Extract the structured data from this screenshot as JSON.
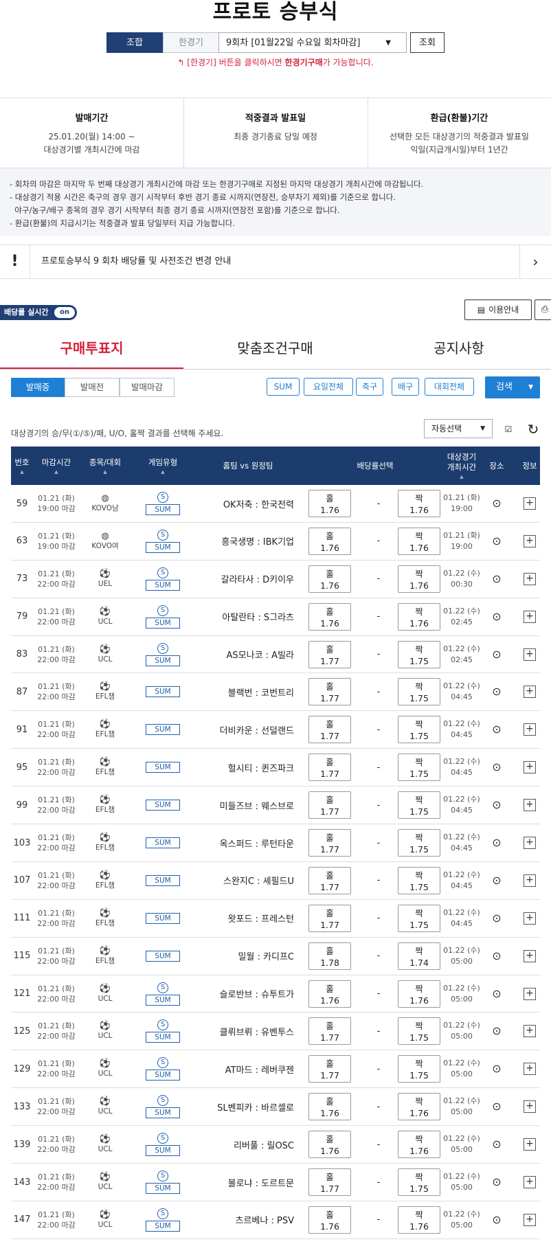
{
  "header": {
    "title": "프로토 승부식"
  },
  "toolbar": {
    "combo_label": "조합",
    "limit_label": "한경기",
    "round_value": "9회차 [01월22일 수요일 회차마감]",
    "search_label": "조회",
    "hint_pre": "[한경기] 버튼을 클릭하시면 ",
    "hint_bold": "한경기구매",
    "hint_post": "가 가능합니다."
  },
  "info": [
    {
      "title": "발매기간",
      "lines": [
        "25.01.20(월) 14:00 ~",
        "대상경기별 개최시간에 마감"
      ]
    },
    {
      "title": "적중결과 발표일",
      "lines": [
        "최종 경기종료 당일 예정"
      ]
    },
    {
      "title": "환급(환불)기간",
      "lines": [
        "선택한 모든 대상경기의 적중결과 발표일",
        "익일(지급개시일)부터 1년간"
      ]
    }
  ],
  "notes": [
    "- 회차의 마감은 마지막 두 번째 대상경기 개최시간에 마감 또는 한경기구매로 지정된 마지막 대상경기 개최시간에 마감됩니다.",
    "- 대상경기 적용 시간은 축구의 경우 경기 시작부터 후반 경기 종료 시까지(연장전, 승부차기 제외)를 기준으로 합니다.",
    "  야구/농구/배구 종목의 경우 경기 시작부터 최종 경기 종료 시까지(연장전 포함)를 기준으로 합니다.",
    "- 환급(환불)의 지급시기는 적중결과 발표 당일부터 지급 가능합니다."
  ],
  "notice_bar": {
    "text": "프로토승부식 9 회차 배당률 및 사전조건 변경 안내"
  },
  "live_toggle": {
    "label": "배당률 실시간",
    "state": "on"
  },
  "guide_button": {
    "label": "이용안내"
  },
  "tabs": [
    "구매투표지",
    "맞춤조건구매",
    "공지사항"
  ],
  "status_buttons": [
    "발매중",
    "발매전",
    "발매마감"
  ],
  "filters": {
    "sum": "SUM",
    "day": "요일전체",
    "soccer": "축구",
    "volley": "배구",
    "league": "대회전체",
    "search": "검색"
  },
  "select_guide": "대상경기의 승/무(①/⑤)/패, U/O, 홀짝 결과를 선택해 주세요.",
  "auto_select": "자동선택",
  "table": {
    "headers": {
      "no": "번호",
      "deadline": "마감시간",
      "league": "종목/대회",
      "type": "게임유형",
      "teams": "홈팀 vs 원정팀",
      "odds": "배당률선택",
      "kickoff1": "대상경기",
      "kickoff2": "개최시간",
      "venue": "장소",
      "info": "정보"
    },
    "rows": [
      {
        "no": "59",
        "dl_date": "01.21 (화)",
        "dl_time": "19:00 마감",
        "sport": "volley",
        "league": "KOVO남",
        "special": true,
        "teams": "OK저축 : 한국전력",
        "odd1_label": "홀",
        "odd1": "1.76",
        "dash": "-",
        "odd2_label": "짝",
        "odd2": "1.76",
        "ko_date": "01.21 (화)",
        "ko_time": "19:00"
      },
      {
        "no": "63",
        "dl_date": "01.21 (화)",
        "dl_time": "19:00 마감",
        "sport": "volley",
        "league": "KOVO여",
        "special": true,
        "teams": "흥국생명 : IBK기업",
        "odd1_label": "홀",
        "odd1": "1.76",
        "dash": "-",
        "odd2_label": "짝",
        "odd2": "1.76",
        "ko_date": "01.21 (화)",
        "ko_time": "19:00"
      },
      {
        "no": "73",
        "dl_date": "01.21 (화)",
        "dl_time": "22:00 마감",
        "sport": "soccer",
        "league": "UEL",
        "special": true,
        "teams": "갈라타사 : D키이우",
        "odd1_label": "홀",
        "odd1": "1.76",
        "dash": "-",
        "odd2_label": "짝",
        "odd2": "1.76",
        "ko_date": "01.22 (수)",
        "ko_time": "00:30"
      },
      {
        "no": "79",
        "dl_date": "01.21 (화)",
        "dl_time": "22:00 마감",
        "sport": "soccer",
        "league": "UCL",
        "special": true,
        "teams": "아탈란타 : S그라츠",
        "odd1_label": "홀",
        "odd1": "1.76",
        "dash": "-",
        "odd2_label": "짝",
        "odd2": "1.76",
        "ko_date": "01.22 (수)",
        "ko_time": "02:45"
      },
      {
        "no": "83",
        "dl_date": "01.21 (화)",
        "dl_time": "22:00 마감",
        "sport": "soccer",
        "league": "UCL",
        "special": true,
        "teams": "AS모나코 : A빌라",
        "odd1_label": "홀",
        "odd1": "1.77",
        "dash": "-",
        "odd2_label": "짝",
        "odd2": "1.75",
        "ko_date": "01.22 (수)",
        "ko_time": "02:45"
      },
      {
        "no": "87",
        "dl_date": "01.21 (화)",
        "dl_time": "22:00 마감",
        "sport": "soccer",
        "league": "EFL챔",
        "special": false,
        "teams": "블랙번 : 코번트리",
        "odd1_label": "홀",
        "odd1": "1.77",
        "dash": "-",
        "odd2_label": "짝",
        "odd2": "1.75",
        "ko_date": "01.22 (수)",
        "ko_time": "04:45"
      },
      {
        "no": "91",
        "dl_date": "01.21 (화)",
        "dl_time": "22:00 마감",
        "sport": "soccer",
        "league": "EFL챔",
        "special": false,
        "teams": "더비카운 : 선덜랜드",
        "odd1_label": "홀",
        "odd1": "1.77",
        "dash": "-",
        "odd2_label": "짝",
        "odd2": "1.75",
        "ko_date": "01.22 (수)",
        "ko_time": "04:45"
      },
      {
        "no": "95",
        "dl_date": "01.21 (화)",
        "dl_time": "22:00 마감",
        "sport": "soccer",
        "league": "EFL챔",
        "special": false,
        "teams": "헐시티 : 퀸즈파크",
        "odd1_label": "홀",
        "odd1": "1.77",
        "dash": "-",
        "odd2_label": "짝",
        "odd2": "1.75",
        "ko_date": "01.22 (수)",
        "ko_time": "04:45"
      },
      {
        "no": "99",
        "dl_date": "01.21 (화)",
        "dl_time": "22:00 마감",
        "sport": "soccer",
        "league": "EFL챔",
        "special": false,
        "teams": "미들즈브 : 웨스브로",
        "odd1_label": "홀",
        "odd1": "1.77",
        "dash": "-",
        "odd2_label": "짝",
        "odd2": "1.75",
        "ko_date": "01.22 (수)",
        "ko_time": "04:45"
      },
      {
        "no": "103",
        "dl_date": "01.21 (화)",
        "dl_time": "22:00 마감",
        "sport": "soccer",
        "league": "EFL챔",
        "special": false,
        "teams": "옥스퍼드 : 루턴타운",
        "odd1_label": "홀",
        "odd1": "1.77",
        "dash": "-",
        "odd2_label": "짝",
        "odd2": "1.75",
        "ko_date": "01.22 (수)",
        "ko_time": "04:45"
      },
      {
        "no": "107",
        "dl_date": "01.21 (화)",
        "dl_time": "22:00 마감",
        "sport": "soccer",
        "league": "EFL챔",
        "special": false,
        "teams": "스완지C : 셰필드U",
        "odd1_label": "홀",
        "odd1": "1.77",
        "dash": "-",
        "odd2_label": "짝",
        "odd2": "1.75",
        "ko_date": "01.22 (수)",
        "ko_time": "04:45"
      },
      {
        "no": "111",
        "dl_date": "01.21 (화)",
        "dl_time": "22:00 마감",
        "sport": "soccer",
        "league": "EFL챔",
        "special": false,
        "teams": "왓포드 : 프레스턴",
        "odd1_label": "홀",
        "odd1": "1.77",
        "dash": "-",
        "odd2_label": "짝",
        "odd2": "1.75",
        "ko_date": "01.22 (수)",
        "ko_time": "04:45"
      },
      {
        "no": "115",
        "dl_date": "01.21 (화)",
        "dl_time": "22:00 마감",
        "sport": "soccer",
        "league": "EFL챔",
        "special": false,
        "teams": "밀월 : 카디프C",
        "odd1_label": "홀",
        "odd1": "1.78",
        "dash": "-",
        "odd2_label": "짝",
        "odd2": "1.74",
        "ko_date": "01.22 (수)",
        "ko_time": "05:00"
      },
      {
        "no": "121",
        "dl_date": "01.21 (화)",
        "dl_time": "22:00 마감",
        "sport": "soccer",
        "league": "UCL",
        "special": true,
        "teams": "슬로반브 : 슈투트가",
        "odd1_label": "홀",
        "odd1": "1.76",
        "dash": "-",
        "odd2_label": "짝",
        "odd2": "1.76",
        "ko_date": "01.22 (수)",
        "ko_time": "05:00"
      },
      {
        "no": "125",
        "dl_date": "01.21 (화)",
        "dl_time": "22:00 마감",
        "sport": "soccer",
        "league": "UCL",
        "special": true,
        "teams": "클뤼브뤼 : 유벤투스",
        "odd1_label": "홀",
        "odd1": "1.77",
        "dash": "-",
        "odd2_label": "짝",
        "odd2": "1.75",
        "ko_date": "01.22 (수)",
        "ko_time": "05:00"
      },
      {
        "no": "129",
        "dl_date": "01.21 (화)",
        "dl_time": "22:00 마감",
        "sport": "soccer",
        "league": "UCL",
        "special": true,
        "teams": "AT마드 : 레버쿠젠",
        "odd1_label": "홀",
        "odd1": "1.77",
        "dash": "-",
        "odd2_label": "짝",
        "odd2": "1.75",
        "ko_date": "01.22 (수)",
        "ko_time": "05:00"
      },
      {
        "no": "133",
        "dl_date": "01.21 (화)",
        "dl_time": "22:00 마감",
        "sport": "soccer",
        "league": "UCL",
        "special": true,
        "teams": "SL벤피카 : 바르셀로",
        "odd1_label": "홀",
        "odd1": "1.76",
        "dash": "-",
        "odd2_label": "짝",
        "odd2": "1.76",
        "ko_date": "01.22 (수)",
        "ko_time": "05:00"
      },
      {
        "no": "139",
        "dl_date": "01.21 (화)",
        "dl_time": "22:00 마감",
        "sport": "soccer",
        "league": "UCL",
        "special": true,
        "teams": "리버풀 : 릴OSC",
        "odd1_label": "홀",
        "odd1": "1.76",
        "dash": "-",
        "odd2_label": "짝",
        "odd2": "1.76",
        "ko_date": "01.22 (수)",
        "ko_time": "05:00"
      },
      {
        "no": "143",
        "dl_date": "01.21 (화)",
        "dl_time": "22:00 마감",
        "sport": "soccer",
        "league": "UCL",
        "special": true,
        "teams": "볼로냐 : 도르트문",
        "odd1_label": "홀",
        "odd1": "1.77",
        "dash": "-",
        "odd2_label": "짝",
        "odd2": "1.75",
        "ko_date": "01.22 (수)",
        "ko_time": "05:00"
      },
      {
        "no": "147",
        "dl_date": "01.21 (화)",
        "dl_time": "22:00 마감",
        "sport": "soccer",
        "league": "UCL",
        "special": true,
        "teams": "츠르베나 : PSV",
        "odd1_label": "홀",
        "odd1": "1.76",
        "dash": "-",
        "odd2_label": "짝",
        "odd2": "1.76",
        "ko_date": "01.22 (수)",
        "ko_time": "05:00"
      }
    ]
  },
  "colors": {
    "navy": "#1c3c6e",
    "blue": "#1f7fd4",
    "red": "#d5213a"
  }
}
